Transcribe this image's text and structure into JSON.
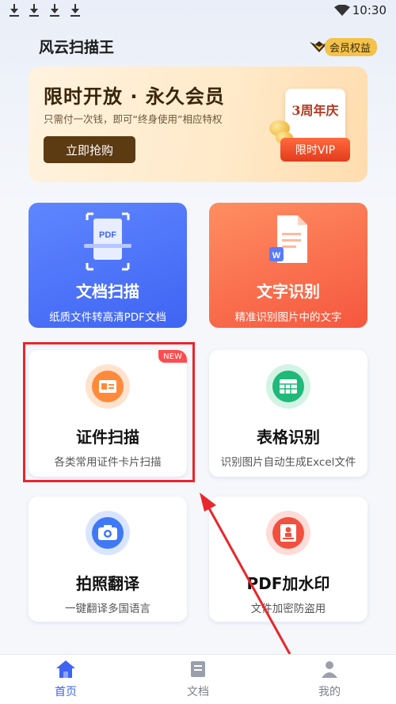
{
  "status_bar": {
    "time": "10:30",
    "download_icons": [
      "download-icon",
      "download-icon",
      "download-icon",
      "download-icon"
    ]
  },
  "header": {
    "title": "风云扫描王",
    "vip_entry": "会员权益"
  },
  "banner": {
    "title": "限时开放 · 永久会员",
    "subtitle": "只需付一次钱，即可“终身使用”相应特权",
    "button": "立即抢购",
    "badge_top": "3周年庆",
    "badge_bottom": "限时VIP"
  },
  "cards": {
    "doc_scan": {
      "title": "文档扫描",
      "subtitle": "纸质文件转高清PDF文档",
      "icon_text": "PDF"
    },
    "text_ocr": {
      "title": "文字识别",
      "subtitle": "精准识别图片中的文字",
      "icon_text": "W"
    },
    "id_scan": {
      "title": "证件扫描",
      "subtitle": "各类常用证件卡片扫描",
      "tag": "NEW"
    },
    "table_ocr": {
      "title": "表格识别",
      "subtitle": "识别图片自动生成Excel文件"
    },
    "photo_translate": {
      "title": "拍照翻译",
      "subtitle": "一键翻译多国语言"
    },
    "pdf_watermark": {
      "title": "PDF加水印",
      "subtitle": "文件加密防盗用"
    }
  },
  "nav": {
    "home": "首页",
    "docs": "文档",
    "me": "我的"
  },
  "colors": {
    "accent": "#3f64f3",
    "highlight": "#e9262b",
    "nav_active": "#3f64f3",
    "nav_inactive": "#9aa0ab"
  }
}
